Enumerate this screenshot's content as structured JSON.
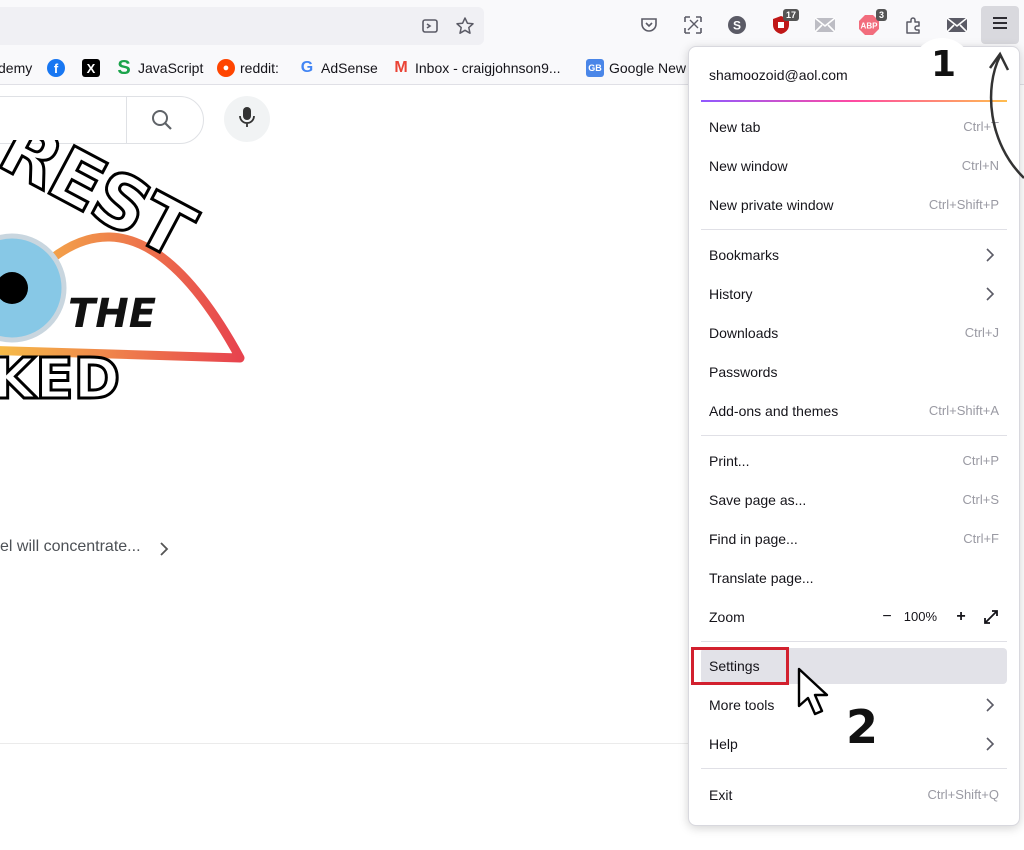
{
  "toolbar": {
    "icons": [
      "reader-mode-icon",
      "bookmark-star-icon",
      "pocket-icon",
      "screenshot-icon",
      "sofast-extension-icon",
      "ublock-extension-icon",
      "mail-extension-icon",
      "adblock-extension-icon",
      "extensions-puzzle-icon",
      "mail-extension-icon-2",
      "hamburger-menu-icon"
    ],
    "ublock_badge": "17",
    "adblock_badge": "3"
  },
  "bookmarks": [
    {
      "label": "demy",
      "icon": "udemy-icon"
    },
    {
      "label": "",
      "icon": "facebook-icon"
    },
    {
      "label": "",
      "icon": "x-icon"
    },
    {
      "label": "JavaScript",
      "icon": "javascript-s-icon"
    },
    {
      "label": "reddit:",
      "icon": "reddit-icon"
    },
    {
      "label": "AdSense",
      "icon": "google-g-icon"
    },
    {
      "label": "Inbox - craigjohnson9...",
      "icon": "gmail-icon"
    },
    {
      "label": "Google New",
      "icon": "google-news-icon"
    }
  ],
  "page": {
    "logo_text_top": "REST",
    "logo_text_mid": "THE",
    "logo_text_bot": "KED",
    "suggestion": "el will concentrate..."
  },
  "menu": {
    "account": "shamoozoid@aol.com",
    "items": [
      {
        "label": "New tab",
        "shortcut": "Ctrl+T"
      },
      {
        "label": "New window",
        "shortcut": "Ctrl+N"
      },
      {
        "label": "New private window",
        "shortcut": "Ctrl+Shift+P"
      },
      {
        "label": "Bookmarks",
        "shortcut": ""
      },
      {
        "label": "History",
        "shortcut": ""
      },
      {
        "label": "Downloads",
        "shortcut": "Ctrl+J"
      },
      {
        "label": "Passwords",
        "shortcut": ""
      },
      {
        "label": "Add-ons and themes",
        "shortcut": "Ctrl+Shift+A"
      },
      {
        "label": "Print...",
        "shortcut": "Ctrl+P"
      },
      {
        "label": "Save page as...",
        "shortcut": "Ctrl+S"
      },
      {
        "label": "Find in page...",
        "shortcut": "Ctrl+F"
      },
      {
        "label": "Translate page...",
        "shortcut": ""
      },
      {
        "label": "Zoom",
        "shortcut": ""
      },
      {
        "label": "Settings",
        "shortcut": ""
      },
      {
        "label": "More tools",
        "shortcut": ""
      },
      {
        "label": "Help",
        "shortcut": ""
      },
      {
        "label": "Exit",
        "shortcut": "Ctrl+Shift+Q"
      }
    ],
    "zoom": {
      "minus": "−",
      "value": "100%",
      "plus": "+"
    }
  },
  "annotations": {
    "step1": "1",
    "step2": "2"
  },
  "colors": {
    "highlight_box": "#d2202e",
    "account_gradient": [
      "#9059ff",
      "#ff4aa2",
      "#ffbd4f"
    ]
  }
}
